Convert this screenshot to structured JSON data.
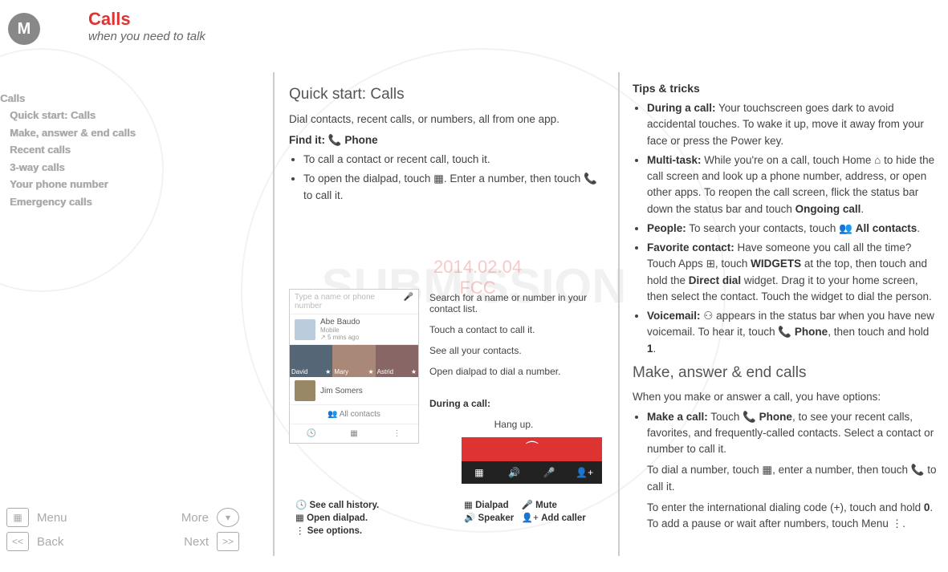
{
  "header": {
    "title": "Calls",
    "subtitle": "when you need to talk",
    "logo_letter": "M"
  },
  "sidebar": {
    "section": "Calls",
    "items": [
      "Quick start: Calls",
      "Make, answer & end calls",
      "Recent calls",
      "3-way calls",
      "Your phone number",
      "Emergency calls"
    ]
  },
  "nav": {
    "menu": "Menu",
    "more": "More",
    "back": "Back",
    "next": "Next"
  },
  "watermark_date": "2014.02.04",
  "watermark_sub": "FCC",
  "mid": {
    "heading": "Quick start: Calls",
    "intro": "Dial contacts, recent calls, or numbers, all from one app.",
    "find_label": "Find it:",
    "find_target": "Phone",
    "bul1": "To call a contact or recent call, touch it.",
    "bul2a": "To open the dialpad, touch ",
    "bul2b": ". Enter a number, then touch ",
    "bul2c": " to call it."
  },
  "phone_mock": {
    "search_placeholder": "Type a name or phone number",
    "recent_name": "Abe Baudo",
    "recent_sub": "Mobile",
    "recent_time": "5 mins ago",
    "fav1": "David",
    "fav2": "Mary",
    "fav3": "Astrid",
    "contact_row": "Jim Somers",
    "all_contacts": "All contacts"
  },
  "callouts": {
    "c1": "Search for a name or number in your contact list.",
    "c2": "Touch a contact to call it.",
    "c3": "See all your contacts.",
    "c4": "Open dialpad to dial a number.",
    "during": "During a call:",
    "hangup": "Hang up."
  },
  "legend_left": {
    "l1": "See call history.",
    "l2": "Open dialpad.",
    "l3": "See options."
  },
  "legend_right": {
    "r1a": "Dialpad",
    "r1b": "Mute",
    "r2a": "Speaker",
    "r2b": "Add caller"
  },
  "right": {
    "tips_h": "Tips & tricks",
    "t1a": "During a call:",
    "t1b": " Your touchscreen goes dark to avoid accidental touches. To wake it up, move it away from your face or press the Power key.",
    "t2a": "Multi-task:",
    "t2b": " While you're on a call, touch Home ",
    "t2c": " to hide the call screen and look up a phone number, address, or open other apps. To reopen the call screen, flick the status bar down the status bar and touch ",
    "t2d": "Ongoing call",
    "t3a": "People:",
    "t3b": " To search your contacts, touch ",
    "t3c": "All contacts",
    "t4a": "Favorite contact:",
    "t4b": " Have someone you call all the time? Touch Apps ",
    "t4c": ", touch ",
    "t4d": "WIDGETS",
    "t4e": " at the top, then touch and hold the ",
    "t4f": "Direct dial",
    "t4g": "  widget. Drag it to your home screen, then select the contact. Touch the widget to dial the person.",
    "t5a": "Voicemail:",
    "t5b": " appears in the status bar when you have new voicemail. To hear it, touch ",
    "t5c": "Phone",
    "t5d": ", then touch and hold ",
    "t5e": "1",
    "h2": "Make, answer & end calls",
    "h2sub": "When you make or answer a call, you have options:",
    "m1a": "Make a call:",
    "m1b": " Touch ",
    "m1c": "Phone",
    "m1d": ", to see your recent calls, favorites, and frequently-called contacts. Select a contact or number to call it.",
    "m2a": "To dial a number, touch  ",
    "m2b": ", enter a number, then touch ",
    "m2c": " to call it.",
    "m3a": "To enter the international dialing code (+), touch and hold ",
    "m3b": "0",
    "m3c": ". To add a pause or wait after numbers, touch Menu ",
    "m3d": "."
  }
}
